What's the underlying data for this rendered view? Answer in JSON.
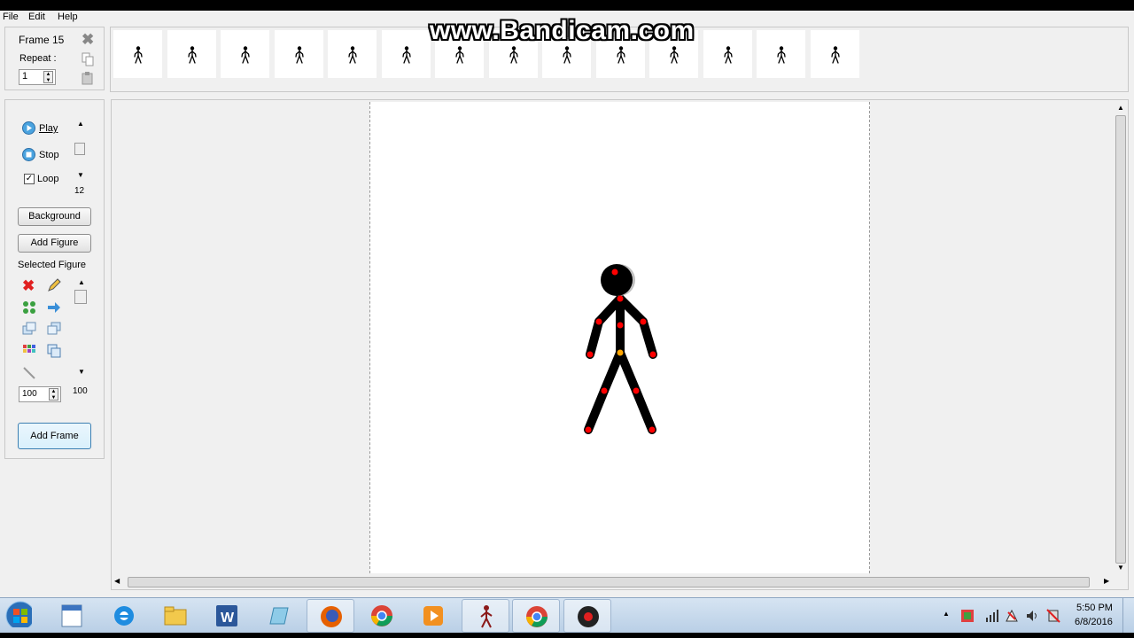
{
  "menu": [
    "File",
    "Edit",
    "Help"
  ],
  "watermark": "www.Bandicam.com",
  "frame_panel": {
    "frame_label": "Frame 15",
    "repeat_label": "Repeat :",
    "repeat_value": "1"
  },
  "frame_strip": {
    "thumbnail_count": 14
  },
  "playback": {
    "play_label": "Play",
    "stop_label": "Stop",
    "loop_label": "Loop",
    "loop_checked": true,
    "fps_value": "12"
  },
  "buttons": {
    "background_label": "Background",
    "add_figure_label": "Add Figure",
    "add_frame_label": "Add Frame"
  },
  "selected_figure": {
    "label": "Selected Figure",
    "scale_value": "100",
    "scale_slider_value": "100"
  },
  "taskbar": {
    "time": "5:50 PM",
    "date": "6/8/2016"
  },
  "colors": {
    "joint": "#ff0000",
    "center_joint": "#ffa500",
    "figure": "#000000"
  }
}
